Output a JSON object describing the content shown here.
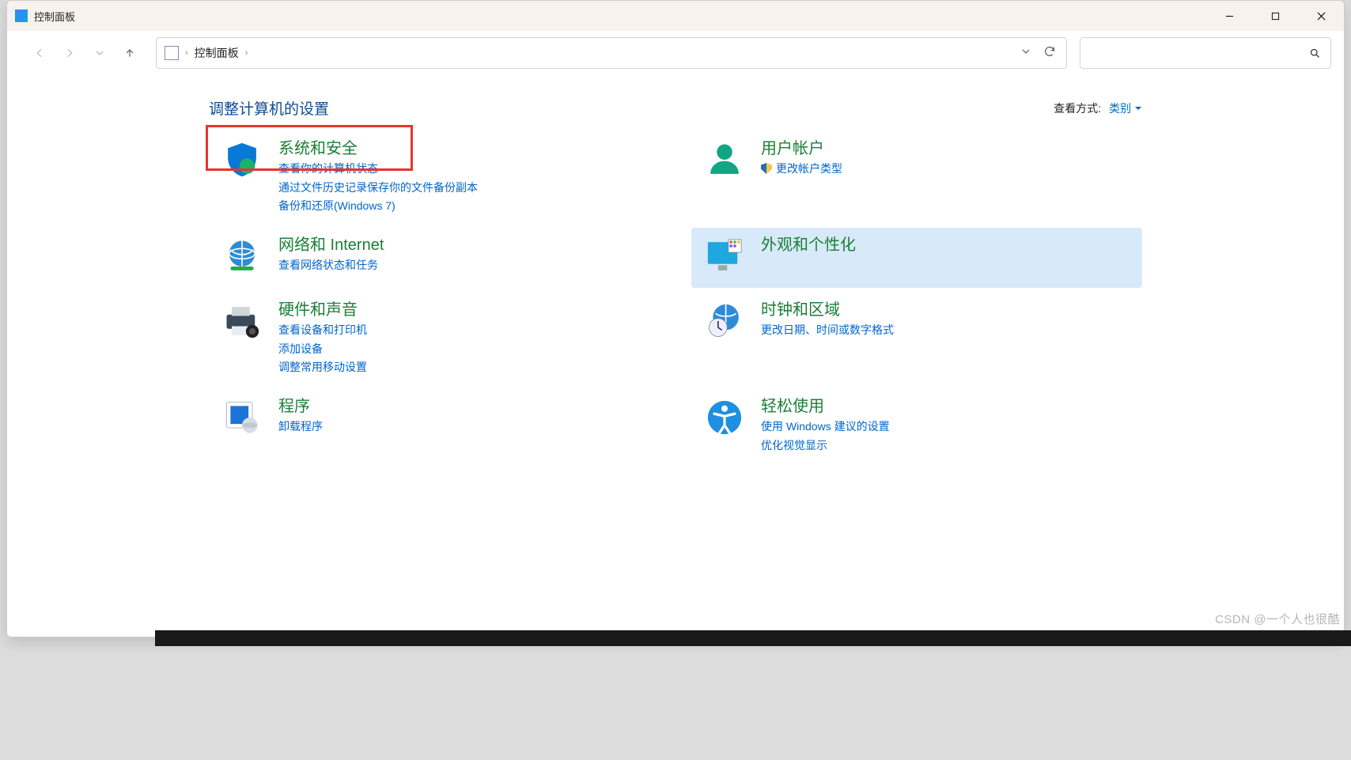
{
  "window": {
    "title": "控制面板"
  },
  "breadcrumb": {
    "root": "控制面板"
  },
  "heading": "调整计算机的设置",
  "viewby": {
    "label": "查看方式:",
    "value": "类别"
  },
  "left": {
    "system": {
      "title": "系统和安全",
      "links": [
        "查看你的计算机状态",
        "通过文件历史记录保存你的文件备份副本",
        "备份和还原(Windows 7)"
      ]
    },
    "network": {
      "title": "网络和 Internet",
      "links": [
        "查看网络状态和任务"
      ]
    },
    "hardware": {
      "title": "硬件和声音",
      "links": [
        "查看设备和打印机",
        "添加设备",
        "调整常用移动设置"
      ]
    },
    "programs": {
      "title": "程序",
      "links": [
        "卸载程序"
      ]
    }
  },
  "right": {
    "users": {
      "title": "用户帐户",
      "links": [
        "更改帐户类型"
      ]
    },
    "appearance": {
      "title": "外观和个性化"
    },
    "clock": {
      "title": "时钟和区域",
      "links": [
        "更改日期、时间或数字格式"
      ]
    },
    "ease": {
      "title": "轻松使用",
      "links": [
        "使用 Windows 建议的设置",
        "优化视觉显示"
      ]
    }
  },
  "watermark": "CSDN @一个人也很酷"
}
